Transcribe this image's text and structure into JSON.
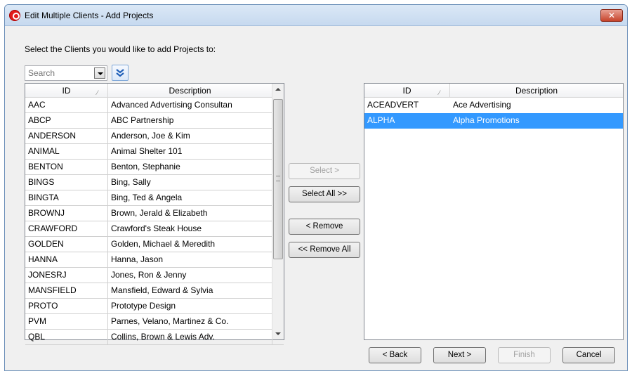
{
  "window": {
    "title": "Edit Multiple Clients - Add Projects",
    "close_label": "✕"
  },
  "instruction": "Select the Clients you would like to add Projects to:",
  "search": {
    "placeholder": "Search"
  },
  "available": {
    "columns": [
      "ID",
      "Description"
    ],
    "rows": [
      [
        "AAC",
        "Advanced Advertising Consultan"
      ],
      [
        "ABCP",
        "ABC Partnership"
      ],
      [
        "ANDERSON",
        "Anderson, Joe & Kim"
      ],
      [
        "ANIMAL",
        "Animal Shelter 101"
      ],
      [
        "BENTON",
        "Benton, Stephanie"
      ],
      [
        "BINGS",
        "Bing, Sally"
      ],
      [
        "BINGTA",
        "Bing, Ted & Angela"
      ],
      [
        "BROWNJ",
        "Brown, Jerald & Elizabeth"
      ],
      [
        "CRAWFORD",
        "Crawford's Steak House"
      ],
      [
        "GOLDEN",
        "Golden, Michael & Meredith"
      ],
      [
        "HANNA",
        "Hanna, Jason"
      ],
      [
        "JONESRJ",
        "Jones, Ron & Jenny"
      ],
      [
        "MANSFIELD",
        "Mansfield, Edward & Sylvia"
      ],
      [
        "PROTO",
        "Prototype Design"
      ],
      [
        "PVM",
        "Parnes, Velano, Martinez & Co."
      ],
      [
        "QBL",
        "Collins, Brown & Lewis Adv."
      ]
    ]
  },
  "selected": {
    "columns": [
      "ID",
      "Description"
    ],
    "rows": [
      [
        "ACEADVERT",
        "Ace Advertising"
      ],
      [
        "ALPHA",
        "Alpha Promotions"
      ]
    ],
    "highlighted_index": 1
  },
  "transfer": {
    "select": "Select >",
    "select_all": "Select All >>",
    "remove": "< Remove",
    "remove_all": "<< Remove All"
  },
  "wizard": {
    "back": "< Back",
    "next": "Next >",
    "finish": "Finish",
    "cancel": "Cancel"
  },
  "colors": {
    "selection": "#3399ff",
    "title_bar": "#c6d9ef",
    "close": "#c7432b"
  }
}
